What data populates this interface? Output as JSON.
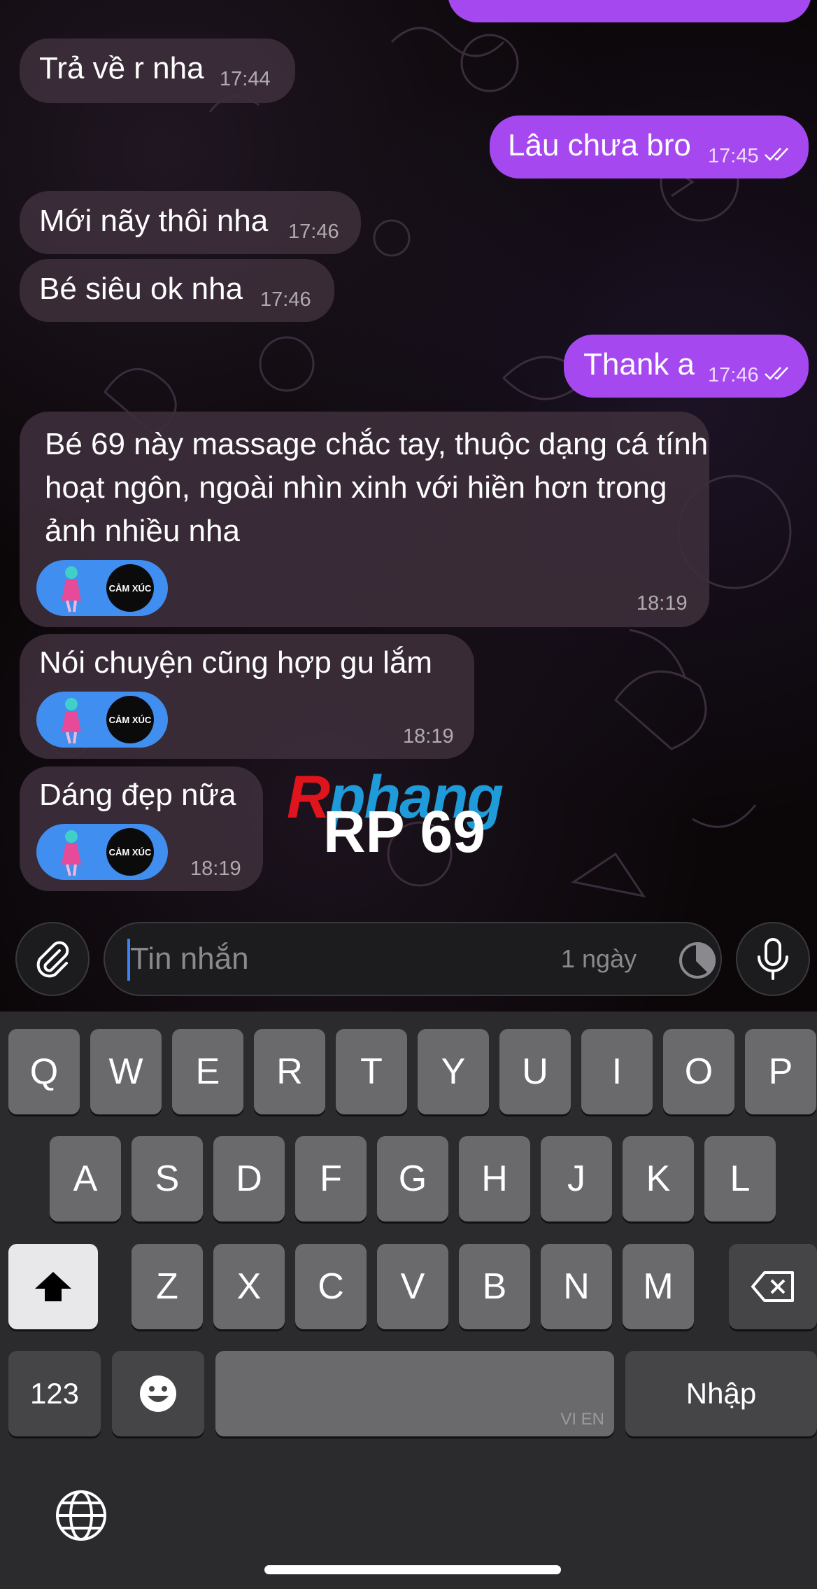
{
  "messages": [
    {
      "dir": "in",
      "text": "Trả về r nha",
      "time": "17:44"
    },
    {
      "dir": "out",
      "text": "Lâu chưa bro",
      "time": "17:45"
    },
    {
      "dir": "in",
      "text": "Mới nãy thôi nha",
      "time": "17:46"
    },
    {
      "dir": "in",
      "text": "Bé siêu ok nha",
      "time": "17:46"
    },
    {
      "dir": "out",
      "text": "Thank a",
      "time": "17:46"
    },
    {
      "dir": "in",
      "text": "Bé 69 này massage chắc tay, thuộc dạng cá tính hoạt ngôn, ngoài nhìn xinh với hiền hơn trong ảnh nhiều nha",
      "time": "18:19",
      "sticker": "CẢM XÚC"
    },
    {
      "dir": "in",
      "text": "Nói chuyện cũng hợp gu lắm",
      "time": "18:19",
      "sticker": "CẢM XÚC"
    },
    {
      "dir": "in",
      "text": "Dáng đẹp nữa",
      "time": "18:19",
      "sticker": "CẢM XÚC"
    }
  ],
  "watermark": {
    "brand_r": "R",
    "brand_rest": "phang",
    "code": "RP 69"
  },
  "input": {
    "placeholder": "Tin nhắn",
    "timer_label": "1 ngày"
  },
  "keyboard": {
    "row1": [
      "Q",
      "W",
      "E",
      "R",
      "T",
      "Y",
      "U",
      "I",
      "O",
      "P"
    ],
    "row2": [
      "A",
      "S",
      "D",
      "F",
      "G",
      "H",
      "J",
      "K",
      "L"
    ],
    "row3": [
      "Z",
      "X",
      "C",
      "V",
      "B",
      "N",
      "M"
    ],
    "numbers_label": "123",
    "return_label": "Nhập",
    "space_lang": "VI EN"
  },
  "icons": {
    "attach": "paperclip-icon",
    "mic": "microphone-icon",
    "timer": "timer-icon",
    "shift": "shift-icon",
    "delete": "backspace-icon",
    "emoji": "emoji-icon",
    "globe": "globe-icon"
  },
  "colors": {
    "outgoing": "#a548f0",
    "incoming": "#3c2e3a",
    "sticker_pill": "#3f8ef0",
    "keyboard_bg": "#2b2b2d"
  }
}
